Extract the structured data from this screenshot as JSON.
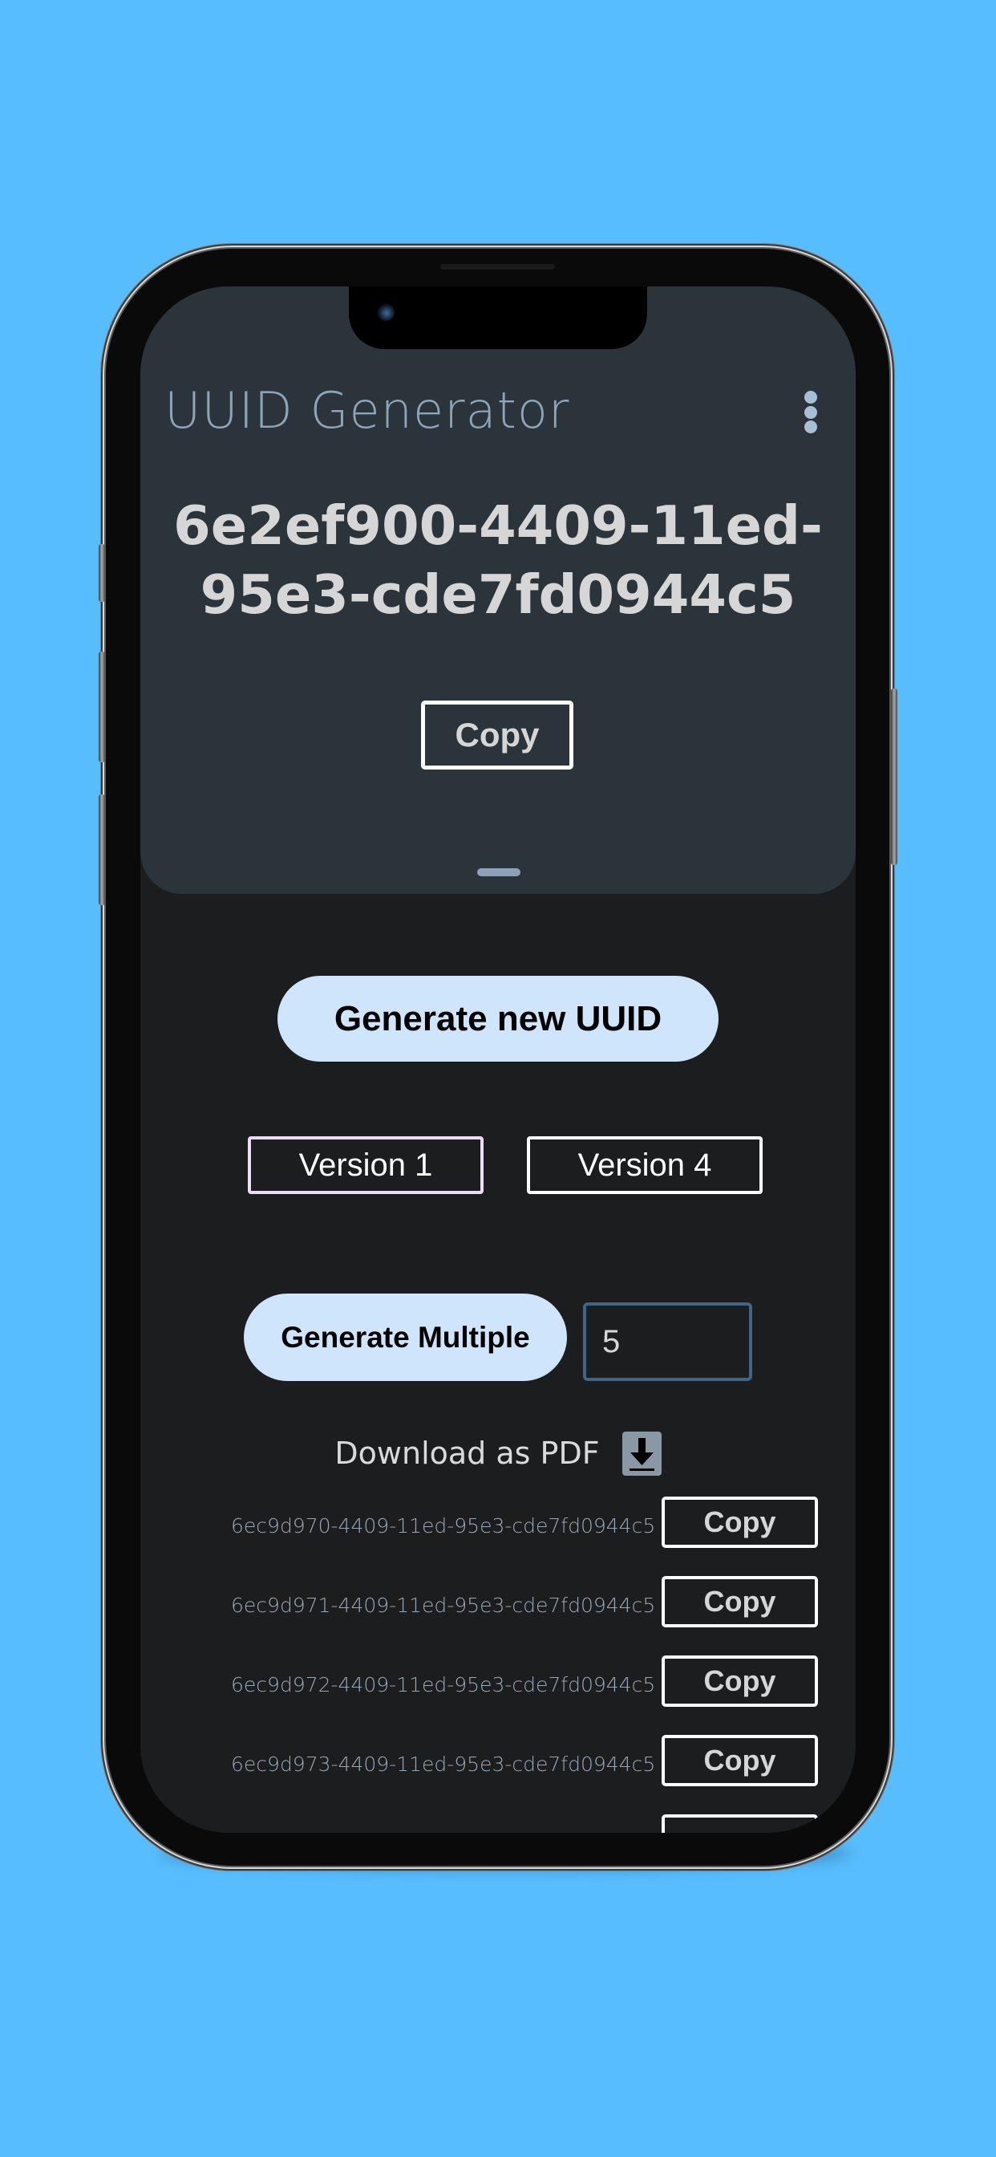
{
  "app": {
    "title": "UUID Generator",
    "menu_icon": "more-vertical-icon"
  },
  "current": {
    "uuid": "6e2ef900-4409-11ed-95e3-cde7fd0944c5",
    "copy_label": "Copy"
  },
  "actions": {
    "generate_new_label": "Generate new UUID",
    "versions": [
      {
        "label": "Version 1",
        "selected": true
      },
      {
        "label": "Version 4",
        "selected": false
      }
    ],
    "generate_multiple_label": "Generate Multiple",
    "count_value": "5",
    "download_label": "Download as PDF",
    "download_icon": "download-icon"
  },
  "list": [
    {
      "uuid": "6ec9d970-4409-11ed-95e3-cde7fd0944c5",
      "copy_label": "Copy"
    },
    {
      "uuid": "6ec9d971-4409-11ed-95e3-cde7fd0944c5",
      "copy_label": "Copy"
    },
    {
      "uuid": "6ec9d972-4409-11ed-95e3-cde7fd0944c5",
      "copy_label": "Copy"
    },
    {
      "uuid": "6ec9d973-4409-11ed-95e3-cde7fd0944c5",
      "copy_label": "Copy"
    },
    {
      "uuid": "",
      "copy_label": ""
    }
  ],
  "colors": {
    "background": "#57bdfc",
    "header_panel": "#2b343b",
    "body": "#1c1d1f",
    "accent_button": "#cfe5fc",
    "title_text": "#8ea4b9",
    "selected_version_border": "#ecdcf5",
    "input_border": "#3f6683"
  }
}
